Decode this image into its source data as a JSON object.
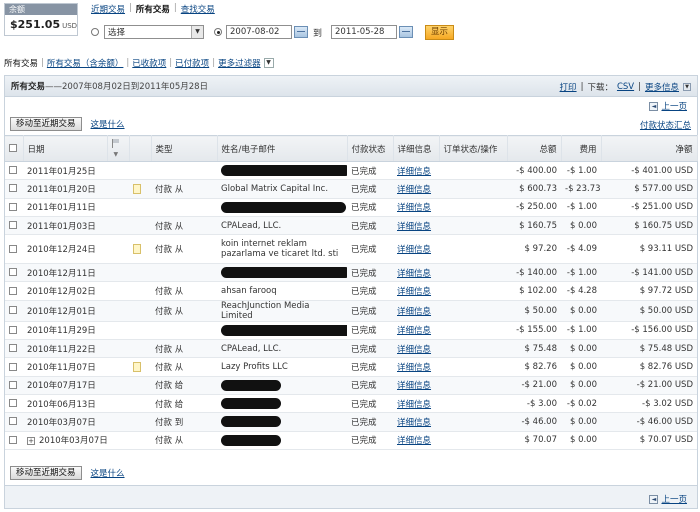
{
  "balance": {
    "label": "余额",
    "amount": "$251.05",
    "currency": "USD"
  },
  "top_tabs": [
    "近期交易",
    "所有交易",
    "查找交易"
  ],
  "filter": {
    "select_value": "选择",
    "date_from": "2007-08-02",
    "to_label": "到",
    "date_to": "2011-05-28",
    "show_button": "显示"
  },
  "sub_nav": {
    "all": "所有交易",
    "all_with_balance": "所有交易（含余额）",
    "received": "已收款项",
    "paid": "已付款项",
    "more_filters": "更多过滤器"
  },
  "panel": {
    "title": "所有交易",
    "range": "——2007年08月02日到2011年05月28日",
    "print": "打印",
    "download_label": "下载：",
    "csv": "CSV",
    "more_info": "更多信息",
    "prev_page": "上一页",
    "archive_button": "移动至近期交易",
    "whats_this": "这是什么",
    "payment_status_summary": "付款状态汇总"
  },
  "columns": [
    "日期",
    "类型",
    "姓名/电子邮件",
    "付款状态",
    "详细信息",
    "订单状态/操作",
    "总额",
    "费用",
    "净额"
  ],
  "rows": [
    {
      "date": "2011年01月25日",
      "note": false,
      "type": "",
      "name": "",
      "redact": 130,
      "status": "已完成",
      "details": "详细信息",
      "gross": "-$ 400.00",
      "fee": "-$ 1.00",
      "net": "-$ 401.00 USD"
    },
    {
      "date": "2011年01月20日",
      "note": true,
      "type": "付款 从",
      "name": "Global Matrix Capital Inc.",
      "redact": 0,
      "status": "已完成",
      "details": "详细信息",
      "gross": "$ 600.73",
      "fee": "-$ 23.73",
      "net": "$ 577.00 USD"
    },
    {
      "date": "2011年01月11日",
      "note": false,
      "type": "",
      "name": "",
      "redact": 125,
      "status": "已完成",
      "details": "详细信息",
      "gross": "-$ 250.00",
      "fee": "-$ 1.00",
      "net": "-$ 251.00 USD"
    },
    {
      "date": "2011年01月03日",
      "note": false,
      "type": "付款 从",
      "name": "CPALead, LLC.",
      "redact": 0,
      "status": "已完成",
      "details": "详细信息",
      "gross": "$ 160.75",
      "fee": "$ 0.00",
      "net": "$ 160.75 USD"
    },
    {
      "date": "2010年12月24日",
      "note": true,
      "type": "付款 从",
      "name": "koin internet reklam pazarlama ve ticaret ltd. sti",
      "redact": 0,
      "status": "已完成",
      "details": "详细信息",
      "gross": "$ 97.20",
      "fee": "-$ 4.09",
      "net": "$ 93.11 USD",
      "tall": true
    },
    {
      "date": "2010年12月11日",
      "note": false,
      "type": "",
      "name": "",
      "redact": 130,
      "status": "已完成",
      "details": "详细信息",
      "gross": "-$ 140.00",
      "fee": "-$ 1.00",
      "net": "-$ 141.00 USD"
    },
    {
      "date": "2010年12月02日",
      "note": false,
      "type": "付款 从",
      "name": "ahsan farooq",
      "redact": 0,
      "status": "已完成",
      "details": "详细信息",
      "gross": "$ 102.00",
      "fee": "-$ 4.28",
      "net": "$ 97.72 USD"
    },
    {
      "date": "2010年12月01日",
      "note": false,
      "type": "付款 从",
      "name": "ReachJunction Media Limited",
      "redact": 0,
      "status": "已完成",
      "details": "详细信息",
      "gross": "$ 50.00",
      "fee": "$ 0.00",
      "net": "$ 50.00 USD"
    },
    {
      "date": "2010年11月29日",
      "note": false,
      "type": "",
      "name": "",
      "redact": 140,
      "status": "已完成",
      "details": "详细信息",
      "gross": "-$ 155.00",
      "fee": "-$ 1.00",
      "net": "-$ 156.00 USD"
    },
    {
      "date": "2010年11月22日",
      "note": false,
      "type": "付款 从",
      "name": "CPALead, LLC.",
      "redact": 0,
      "status": "已完成",
      "details": "详细信息",
      "gross": "$ 75.48",
      "fee": "$ 0.00",
      "net": "$ 75.48 USD"
    },
    {
      "date": "2010年11月07日",
      "note": true,
      "type": "付款 从",
      "name": "Lazy Profits LLC",
      "redact": 0,
      "status": "已完成",
      "details": "详细信息",
      "gross": "$ 82.76",
      "fee": "$ 0.00",
      "net": "$ 82.76 USD"
    },
    {
      "date": "2010年07月17日",
      "note": false,
      "type": "付款 给",
      "name": "",
      "redact": 60,
      "status": "已完成",
      "details": "详细信息",
      "gross": "-$ 21.00",
      "fee": "$ 0.00",
      "net": "-$ 21.00 USD"
    },
    {
      "date": "2010年06月13日",
      "note": false,
      "type": "付款 给",
      "name": "",
      "redact": 60,
      "status": "已完成",
      "details": "详细信息",
      "gross": "-$ 3.00",
      "fee": "-$ 0.02",
      "net": "-$ 3.02 USD"
    },
    {
      "date": "2010年03月07日",
      "note": false,
      "type": "付款 到",
      "name": "",
      "redact": 60,
      "status": "已完成",
      "details": "详细信息",
      "gross": "-$ 46.00",
      "fee": "$ 0.00",
      "net": "-$ 46.00 USD"
    },
    {
      "date": "2010年03月07日",
      "note": false,
      "plus": true,
      "type": "付款 从",
      "name": "",
      "redact": 60,
      "status": "已完成",
      "details": "详细信息",
      "gross": "$ 70.07",
      "fee": "$ 0.00",
      "net": "$ 70.07 USD"
    }
  ]
}
